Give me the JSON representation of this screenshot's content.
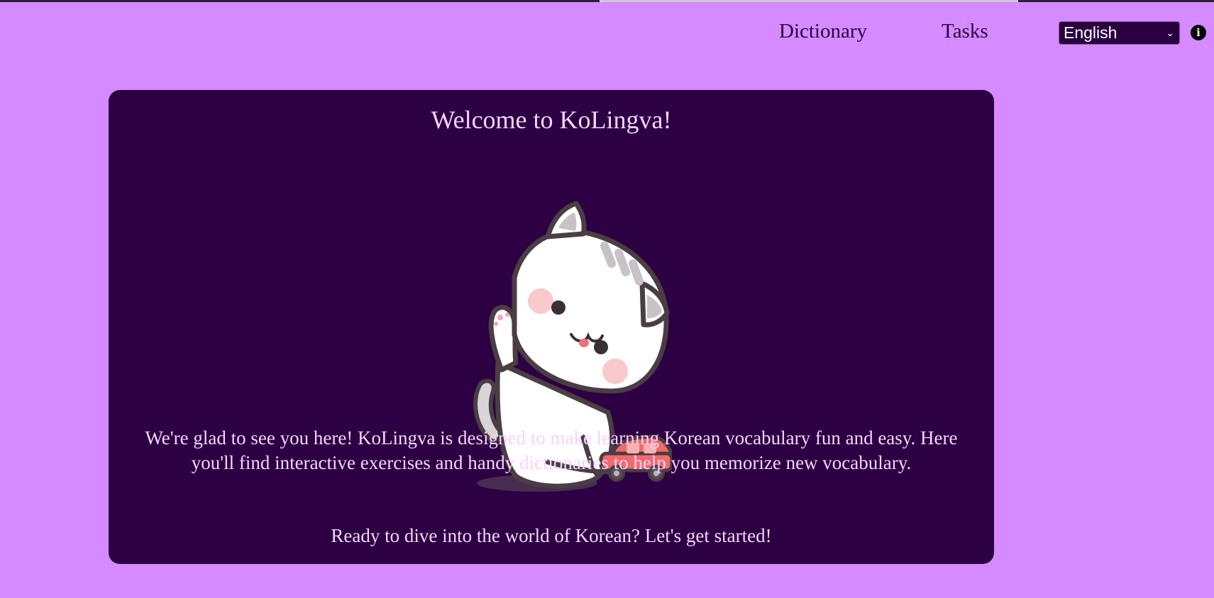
{
  "nav": {
    "dictionary_label": "Dictionary",
    "tasks_label": "Tasks"
  },
  "language": {
    "selected": "English",
    "chevron_icon": "chevron-down-icon",
    "info_icon": "info-icon"
  },
  "welcome": {
    "title": "Welcome to KoLingva!",
    "mascot_icon": "cat-mascot-with-toy-car",
    "intro_text": "We're glad to see you here! KoLingva is designed to make learning Korean vocabulary fun and easy. Here you'll find interactive exercises and handy dictionaries to help you memorize new vocabulary.",
    "cta_text": "Ready to dive into the world of Korean? Let's get started!"
  },
  "colors": {
    "page_background": "#d68aff",
    "card_background": "#2c0042",
    "card_text": "#f7d3ff",
    "nav_text": "#2a0040"
  }
}
